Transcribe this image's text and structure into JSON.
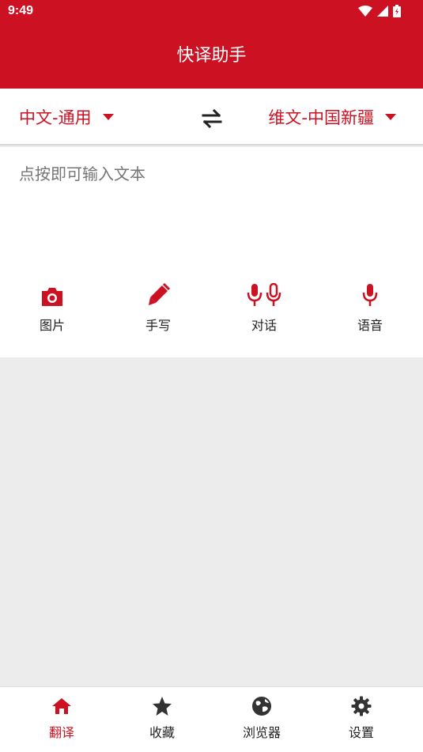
{
  "status_bar": {
    "time": "9:49"
  },
  "header": {
    "title": "快译助手"
  },
  "languages": {
    "source": "中文-通用",
    "target": "维文-中国新疆"
  },
  "input": {
    "placeholder": "点按即可输入文本"
  },
  "tools": [
    {
      "label": "图片",
      "icon": "camera-icon"
    },
    {
      "label": "手写",
      "icon": "pen-icon"
    },
    {
      "label": "对话",
      "icon": "dual-mic-icon"
    },
    {
      "label": "语音",
      "icon": "mic-icon"
    }
  ],
  "nav": [
    {
      "label": "翻译",
      "icon": "home-icon",
      "active": true
    },
    {
      "label": "收藏",
      "icon": "star-icon",
      "active": false
    },
    {
      "label": "浏览器",
      "icon": "globe-icon",
      "active": false
    },
    {
      "label": "设置",
      "icon": "gear-icon",
      "active": false
    }
  ],
  "colors": {
    "accent": "#cc1122",
    "background": "#ececec",
    "text": "#222222",
    "placeholder": "#8a8a8a"
  }
}
